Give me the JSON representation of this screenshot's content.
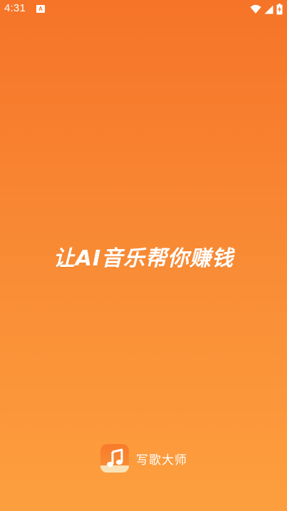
{
  "status_bar": {
    "time": "4:31",
    "notification_icon_letter": "A",
    "icons": [
      "wifi-icon",
      "signal-icon",
      "battery-charging-icon"
    ]
  },
  "splash": {
    "slogan": "让AI音乐帮你赚钱",
    "app_name": "写歌大师",
    "app_icon": "music-note-icon"
  },
  "colors": {
    "background_top": "#F67428",
    "background_bottom": "#FD9F3E",
    "text": "#FFFFFF",
    "icon_base": "#FBE2B6"
  }
}
